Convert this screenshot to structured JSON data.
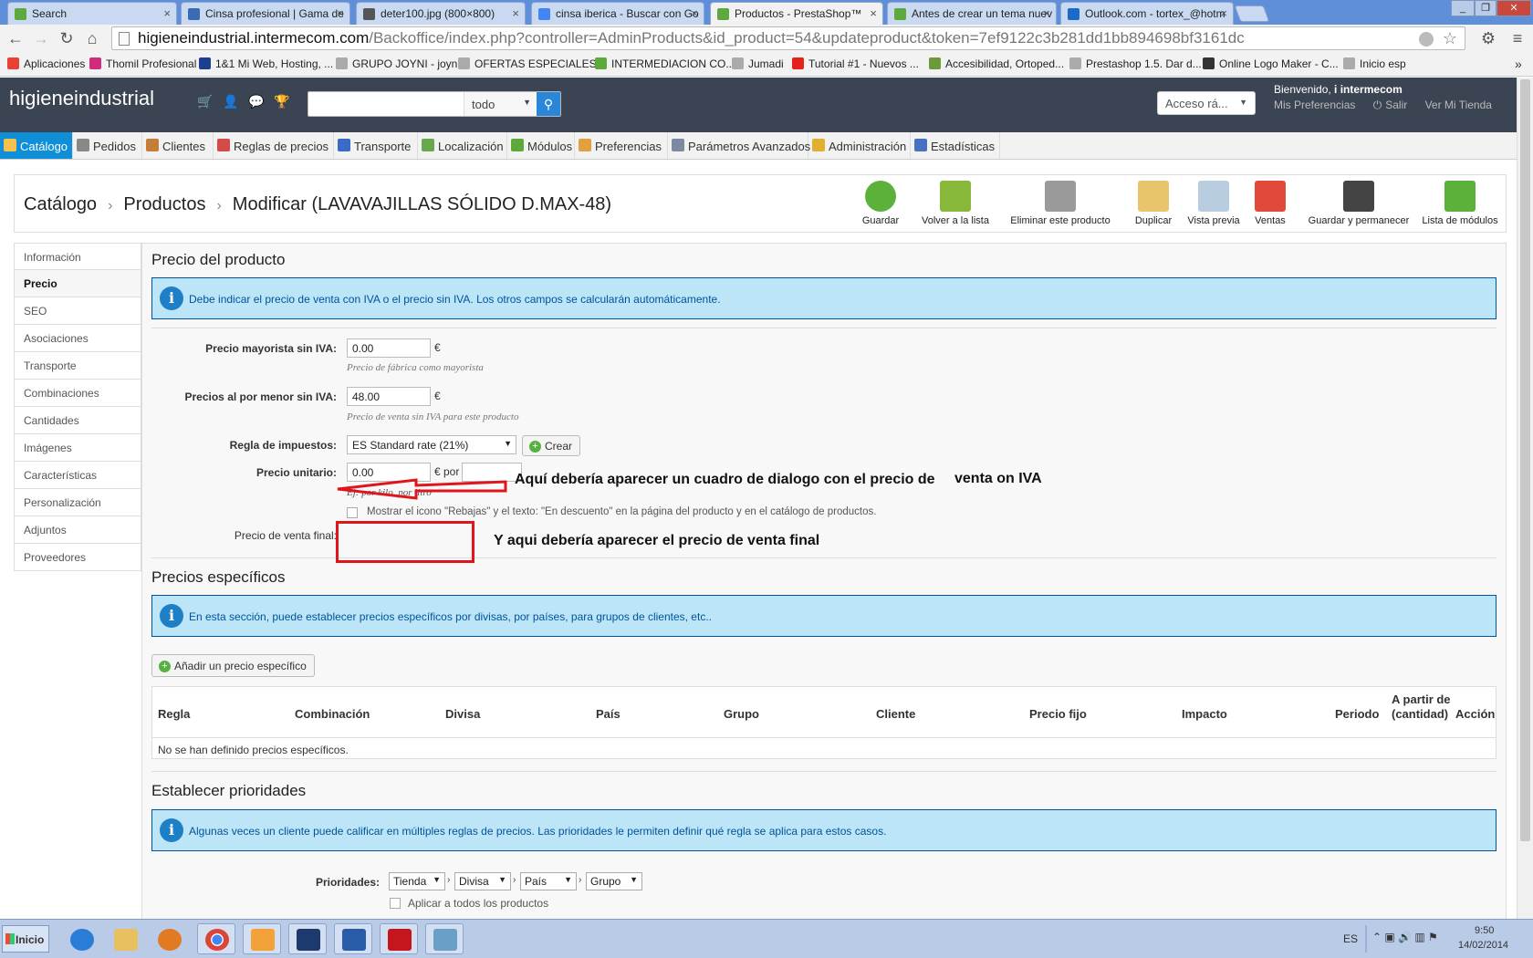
{
  "browser": {
    "tabs": [
      {
        "title": "Search",
        "color": "#5da93c"
      },
      {
        "title": "Cinsa profesional | Gama de",
        "color": "#3b6bb3"
      },
      {
        "title": "deter100.jpg (800×800)",
        "color": "#555555"
      },
      {
        "title": "cinsa iberica - Buscar con Go",
        "color": "#4285f4"
      },
      {
        "title": "Productos - PrestaShop™",
        "color": "#5da93c"
      },
      {
        "title": "Antes de crear un tema nuev",
        "color": "#5da93c"
      },
      {
        "title": "Outlook.com - tortex_@hotm",
        "color": "#1b6ac9"
      }
    ],
    "url_host": "higieneindustrial.intermecom.com",
    "url_path": "/Backoffice/index.php?controller=AdminProducts&id_product=54&updateproduct&token=7ef9122c3b281dd1bb894698bf3161dc",
    "bookmarks": [
      {
        "label": "Aplicaciones",
        "color": "#e94235"
      },
      {
        "label": "Thomil Profesional",
        "color": "#d02b7d"
      },
      {
        "label": "1&1 Mi Web, Hosting, ...",
        "color": "#1d3f8f"
      },
      {
        "label": "GRUPO JOYNI - joyni",
        "color": "#aaaaaa"
      },
      {
        "label": "OFERTAS ESPECIALES...",
        "color": "#aaaaaa"
      },
      {
        "label": "INTERMEDIACION CO...",
        "color": "#5da93c"
      },
      {
        "label": "Jumadi",
        "color": "#aaaaaa"
      },
      {
        "label": "Tutorial #1 - Nuevos ...",
        "color": "#e62117"
      },
      {
        "label": "Accesibilidad, Ortoped...",
        "color": "#6a9a3a"
      },
      {
        "label": "Prestashop 1.5. Dar d...",
        "color": "#aaaaaa"
      },
      {
        "label": "Online Logo Maker - C...",
        "color": "#333333"
      },
      {
        "label": "Inicio esp",
        "color": "#aaaaaa"
      }
    ]
  },
  "header": {
    "brand": "higieneindustrial",
    "search_scope": "todo",
    "quick_access": "Acceso rá...",
    "welcome_prefix": "Bienvenido, ",
    "welcome_user": "i intermecom",
    "links": [
      "Mis Preferencias",
      "Salir",
      "Ver Mi Tienda"
    ]
  },
  "menu": [
    {
      "label": "Catálogo",
      "color": "#f2c14e"
    },
    {
      "label": "Pedidos",
      "color": "#888888"
    },
    {
      "label": "Clientes",
      "color": "#c77d3a"
    },
    {
      "label": "Reglas de precios",
      "color": "#d34a4a"
    },
    {
      "label": "Transporte",
      "color": "#3a6bc7"
    },
    {
      "label": "Localización",
      "color": "#6aa84f"
    },
    {
      "label": "Módulos",
      "color": "#5da93c"
    },
    {
      "label": "Preferencias",
      "color": "#e0a040"
    },
    {
      "label": "Parámetros Avanzados",
      "color": "#7a8aa0"
    },
    {
      "label": "Administración",
      "color": "#e0b030"
    },
    {
      "label": "Estadísticas",
      "color": "#4a70c0"
    }
  ],
  "breadcrumb": [
    "Catálogo",
    "Productos",
    "Modificar (LAVAVAJILLAS SÓLIDO D.MAX-48)"
  ],
  "toolbar": [
    {
      "label": "Guardar",
      "color": "#5cb13a"
    },
    {
      "label": "Volver a la lista",
      "color": "#88b83a"
    },
    {
      "label": "Eliminar este producto",
      "color": "#9a9a9a"
    },
    {
      "label": "Duplicar",
      "color": "#e8c46a"
    },
    {
      "label": "Vista previa",
      "color": "#b8cde0"
    },
    {
      "label": "Ventas",
      "color": "#e14a3a"
    },
    {
      "label": "Guardar y permanecer",
      "color": "#444444"
    },
    {
      "label": "Lista de módulos",
      "color": "#5cb13a"
    }
  ],
  "sidebar": [
    "Información",
    "Precio",
    "SEO",
    "Asociaciones",
    "Transporte",
    "Combinaciones",
    "Cantidades",
    "Imágenes",
    "Características",
    "Personalización",
    "Adjuntos",
    "Proveedores"
  ],
  "price": {
    "title": "Precio del producto",
    "info": "Debe indicar el precio de venta con IVA o el precio sin IVA. Los otros campos se calcularán automáticamente.",
    "wholesale_label": "Precio mayorista sin IVA:",
    "wholesale_value": "0.00",
    "wholesale_hint": "Precio de fábrica como mayorista",
    "retail_label": "Precios al por menor sin IVA:",
    "retail_value": "48.00",
    "retail_hint": "Precio de venta sin IVA para este producto",
    "tax_label": "Regla de impuestos:",
    "tax_value": "ES Standard rate (21%)",
    "create_label": "Crear",
    "unit_label": "Precio unitario:",
    "unit_value": "0.00",
    "unit_per": "€ por",
    "currency": "€",
    "unit_hint": "Ej: por kilo, por litro",
    "discount_label": "Mostrar el icono \"Rebajas\" y el texto: \"En descuento\" en la página del producto y en el catálogo de productos.",
    "final_label": "Precio de venta final:"
  },
  "annotations": {
    "a1": "Aquí debería aparecer un cuadro de dialogo con el precio de",
    "a1b": "venta on IVA",
    "a2": "Y aqui debería aparecer el precio de venta final"
  },
  "specific": {
    "title": "Precios específicos",
    "info": "En esta sección, puede establecer precios específicos por divisas, por países, para grupos de clientes, etc..",
    "add_label": "Añadir un precio específico",
    "columns": [
      "Regla",
      "Combinación",
      "Divisa",
      "País",
      "Grupo",
      "Cliente",
      "Precio fijo",
      "Impacto",
      "Periodo",
      "A partir de (cantidad)",
      "Acción"
    ],
    "empty": "No se han definido precios específicos."
  },
  "priorities": {
    "title": "Establecer prioridades",
    "info": "Algunas veces un cliente puede calificar en múltiples reglas de precios. Las prioridades le permiten definir qué regla se aplica para estos casos.",
    "label": "Prioridades:",
    "options": [
      "Tienda",
      "Divisa",
      "País",
      "Grupo"
    ],
    "apply_all": "Aplicar a todos los productos"
  },
  "taskbar": {
    "start": "Inicio",
    "lang": "ES",
    "time": "9:50",
    "date": "14/02/2014"
  }
}
